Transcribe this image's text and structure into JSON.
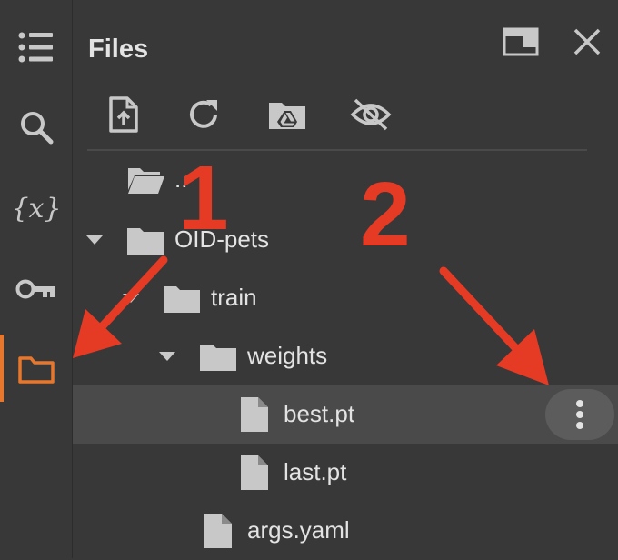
{
  "panel": {
    "title": "Files"
  },
  "tree": [
    {
      "label": "..",
      "type": "folder-up",
      "depth": 0,
      "chevron": false
    },
    {
      "label": "OID-pets",
      "type": "folder",
      "depth": 0,
      "chevron": true
    },
    {
      "label": "train",
      "type": "folder",
      "depth": 1,
      "chevron": true
    },
    {
      "label": "weights",
      "type": "folder",
      "depth": 2,
      "chevron": true
    },
    {
      "label": "best.pt",
      "type": "file",
      "depth": 3,
      "chevron": false,
      "selected": true
    },
    {
      "label": "last.pt",
      "type": "file",
      "depth": 3,
      "chevron": false
    },
    {
      "label": "args.yaml",
      "type": "file",
      "depth": 2,
      "chevron": false
    }
  ],
  "annotations": {
    "step1": "1",
    "step2": "2"
  },
  "colors": {
    "accent": "#e8772e",
    "annotation": "#e53a24",
    "background": "#383838",
    "selected_row": "#4a4a4a"
  }
}
